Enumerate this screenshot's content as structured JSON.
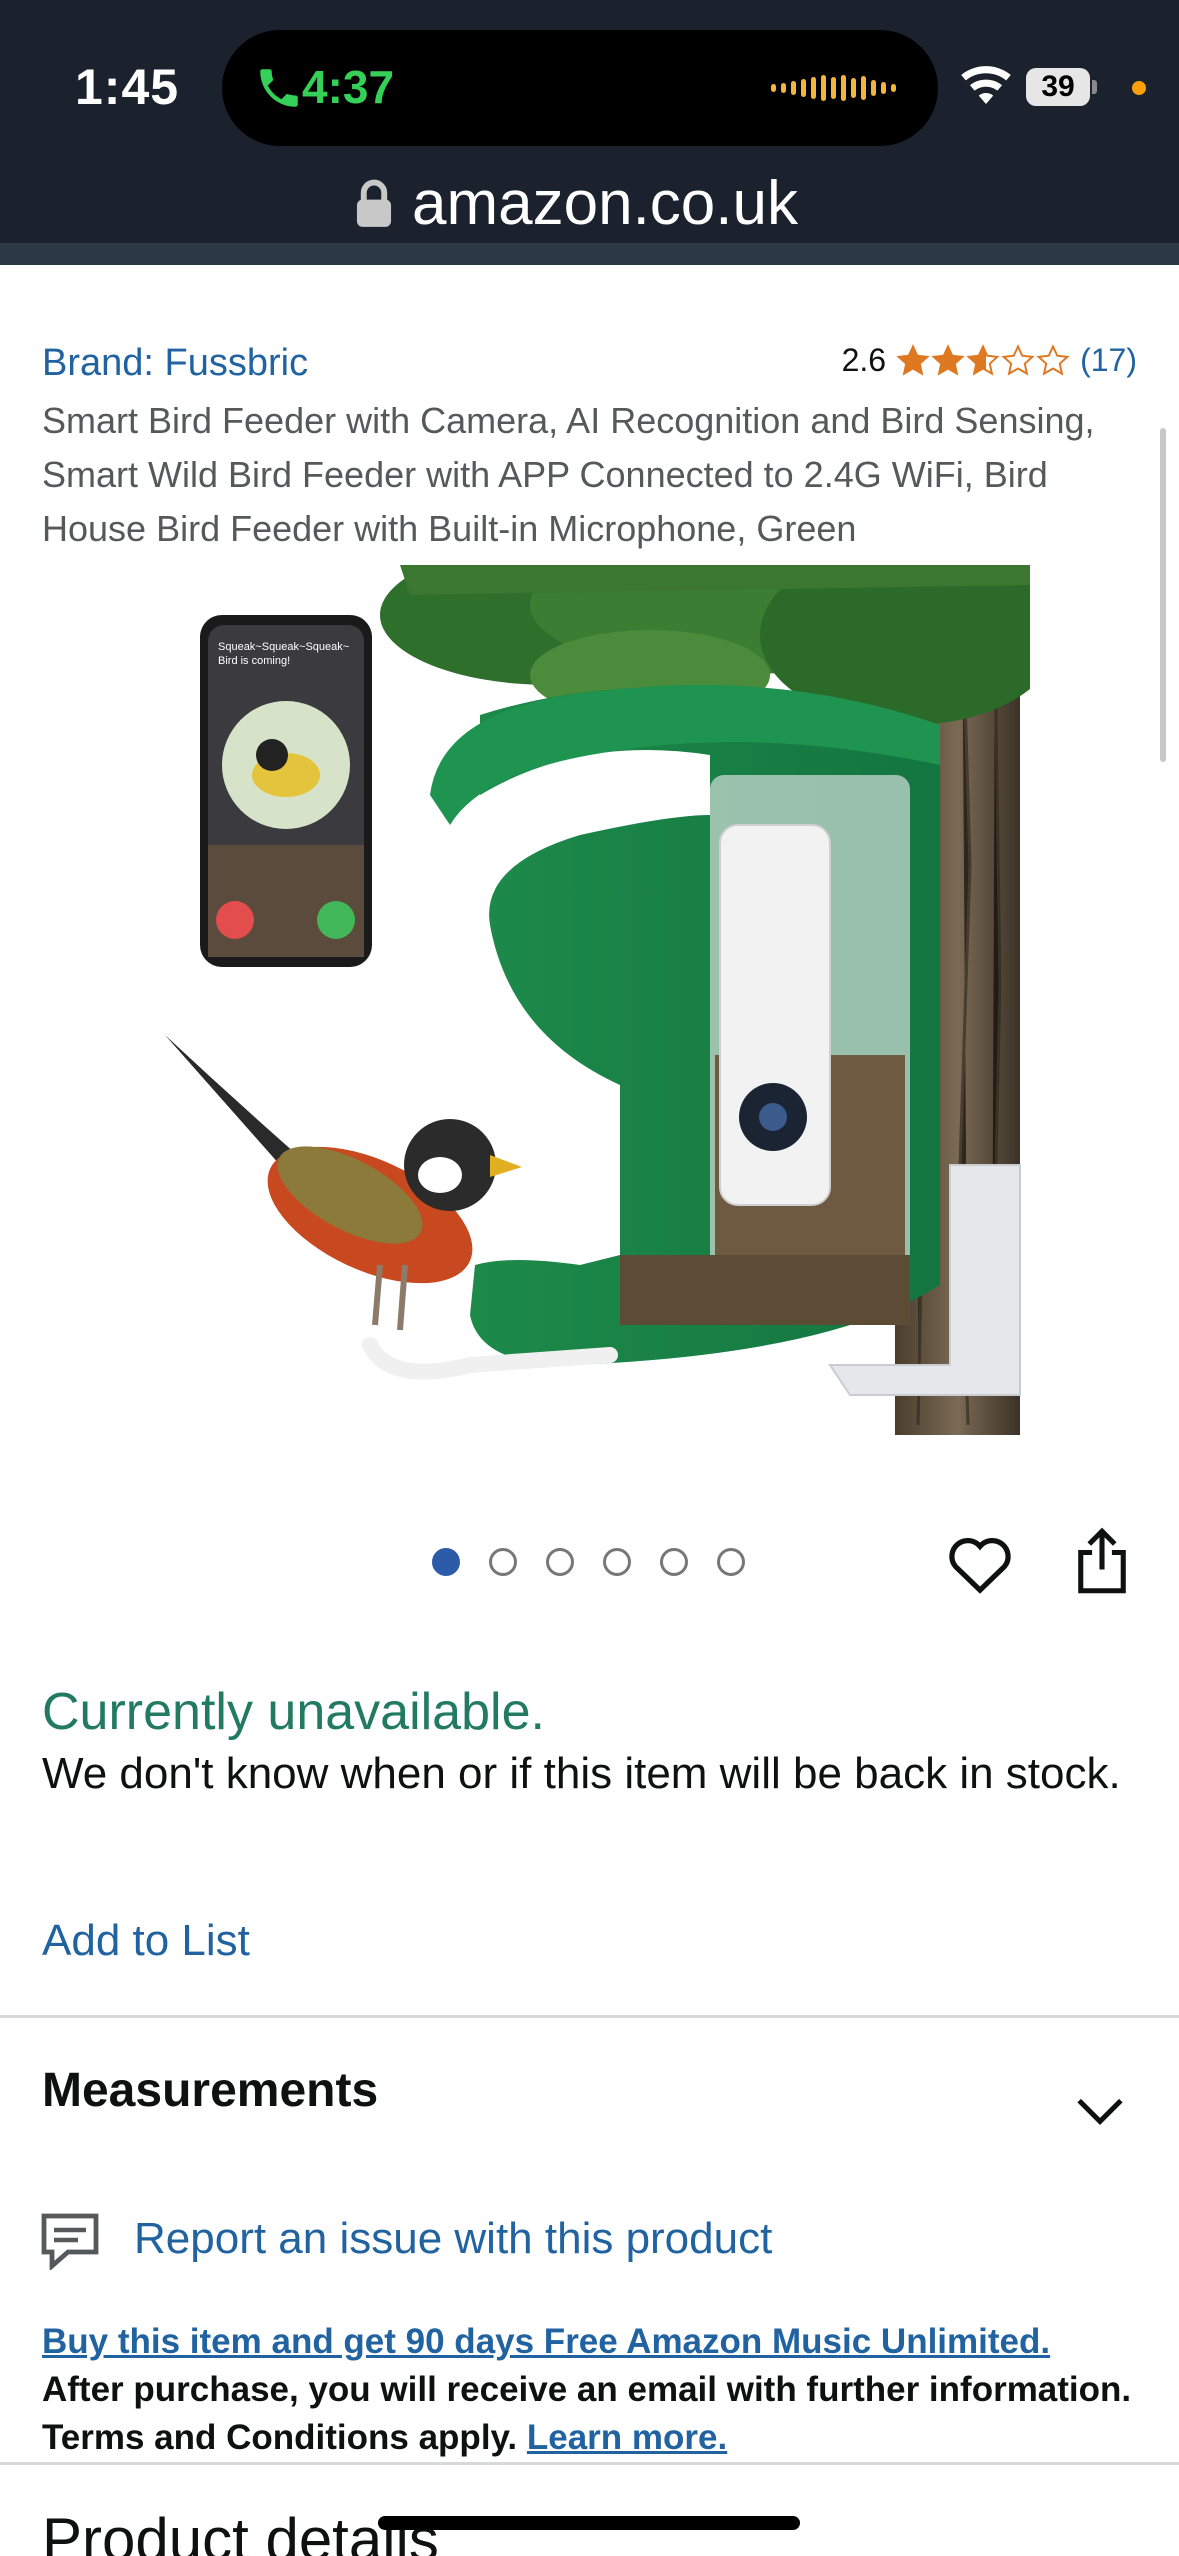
{
  "status_bar": {
    "time": "1:45",
    "call_duration": "4:37",
    "battery": "39"
  },
  "browser": {
    "url": "amazon.co.uk"
  },
  "product": {
    "brand": "Brand: Fussbric",
    "rating": "2.6",
    "rating_value": 2.6,
    "rating_count": "(17)",
    "title": "Smart Bird Feeder with Camera, AI Recognition and Bird Sensing, Smart Wild Bird Feeder with APP Connected to 2.4G WiFi, Bird House Bird Feeder with Built-in Microphone, Green",
    "image": {
      "phone_caption_line1": "Squeak~Squeak~Squeak~",
      "phone_caption_line2": "Bird is coming!"
    },
    "image_count": 6,
    "current_image": 1
  },
  "availability": {
    "status": "Currently unavailable.",
    "message": "We don't know when or if this item will be back in stock.",
    "add_to_list": "Add to List"
  },
  "sections": {
    "measurements": "Measurements",
    "report_issue": "Report an issue with this product",
    "next_section": "Product details"
  },
  "promo": {
    "link_text": "Buy this item and get 90 days Free Amazon Music Unlimited.",
    "body_text": "After purchase, you will receive an email with further information. Terms and Conditions apply.",
    "learn_more": "Learn more."
  },
  "colors": {
    "link": "#2162a1",
    "available_green": "#227b60",
    "star": "#de7921",
    "topbar": "#1b222d"
  },
  "icons": {
    "call": "phone-call-icon",
    "wifi": "wifi-icon",
    "lock": "lock-icon",
    "heart": "heart-icon",
    "share": "share-icon",
    "chevron": "chevron-down-icon",
    "report": "report-icon"
  }
}
